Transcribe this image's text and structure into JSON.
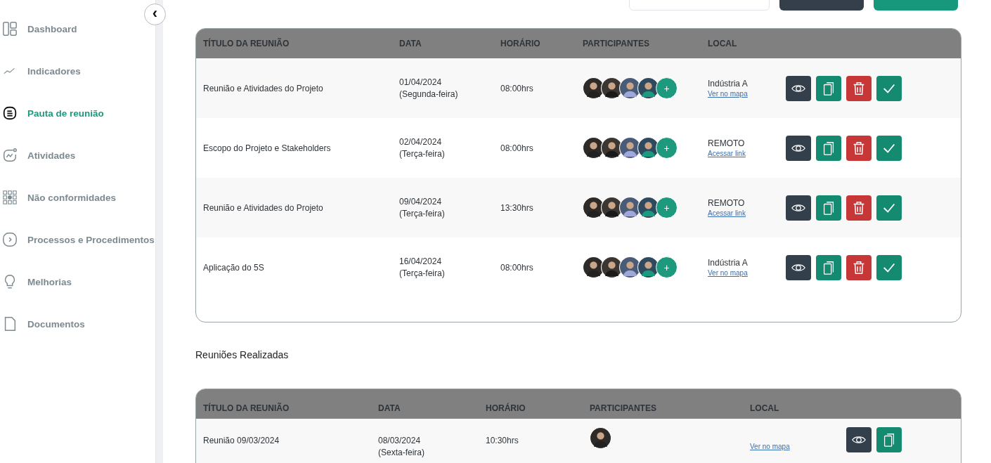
{
  "sidebar": {
    "collapse_label": "‹",
    "items": [
      {
        "label": "Dashboard",
        "selected": false
      },
      {
        "label": "Indicadores",
        "selected": false
      },
      {
        "label": "Pauta de reunião",
        "selected": true
      },
      {
        "label": "Atividades",
        "selected": false
      },
      {
        "label": "Não conformidades",
        "selected": false
      },
      {
        "label": "Processos e Procedimentos",
        "selected": false
      },
      {
        "label": "Melhorias",
        "selected": false
      },
      {
        "label": "Documentos",
        "selected": false
      }
    ]
  },
  "upcoming": {
    "columns": [
      "TÍTULO DA REUNIÃO",
      "DATA",
      "HORÁRIO",
      "PARTICIPANTES",
      "LOCAL"
    ],
    "rows": [
      {
        "title": "Reunião e Atividades do Projeto",
        "date": "01/04/2024",
        "weekday": "(Segunda-feira)",
        "time": "08:00hrs",
        "participants": [
          {
            "kind": "photo"
          },
          {
            "kind": "photo"
          },
          {
            "kind": "photo"
          },
          {
            "kind": "photo"
          },
          {
            "kind": "add",
            "label": "+"
          }
        ],
        "place": "Indústria A",
        "link": "Ver no mapa",
        "actions": [
          {
            "kind": "view"
          },
          {
            "kind": "copy"
          },
          {
            "kind": "delete"
          },
          {
            "kind": "confirm"
          }
        ]
      },
      {
        "title": "Escopo do Projeto e Stakeholders",
        "date": "02/04/2024",
        "weekday": "(Terça-feira)",
        "time": "08:00hrs",
        "participants": [
          {
            "kind": "photo"
          },
          {
            "kind": "photo"
          },
          {
            "kind": "photo"
          },
          {
            "kind": "photo"
          },
          {
            "kind": "add",
            "label": "+"
          }
        ],
        "place": "REMOTO",
        "link": "Acessar link",
        "actions": [
          {
            "kind": "view"
          },
          {
            "kind": "copy"
          },
          {
            "kind": "delete"
          },
          {
            "kind": "confirm"
          }
        ]
      },
      {
        "title": "Reunião e Atividades do Projeto",
        "date": "09/04/2024",
        "weekday": "(Terça-feira)",
        "time": "13:30hrs",
        "participants": [
          {
            "kind": "photo"
          },
          {
            "kind": "photo"
          },
          {
            "kind": "photo"
          },
          {
            "kind": "photo"
          },
          {
            "kind": "add",
            "label": "+"
          }
        ],
        "place": "REMOTO",
        "link": "Acessar link",
        "actions": [
          {
            "kind": "view"
          },
          {
            "kind": "copy"
          },
          {
            "kind": "delete"
          },
          {
            "kind": "confirm"
          }
        ]
      },
      {
        "title": "Aplicação do 5S",
        "date": "16/04/2024",
        "weekday": "(Terça-feira)",
        "time": "08:00hrs",
        "participants": [
          {
            "kind": "photo"
          },
          {
            "kind": "photo"
          },
          {
            "kind": "photo"
          },
          {
            "kind": "photo"
          },
          {
            "kind": "add",
            "label": "+"
          }
        ],
        "place": "Indústria A",
        "link": "Ver no mapa",
        "actions": [
          {
            "kind": "view"
          },
          {
            "kind": "copy"
          },
          {
            "kind": "delete"
          },
          {
            "kind": "confirm"
          }
        ]
      }
    ]
  },
  "done_heading": "Reuniões Realizadas",
  "done": {
    "columns": [
      "TÍTULO DA REUNIÃO",
      "DATA",
      "HORÁRIO",
      "PARTICIPANTES",
      "LOCAL"
    ],
    "rows": [
      {
        "title": "Reunião 09/03/2024",
        "date": "08/03/2024",
        "weekday": "(Sexta-feira)",
        "time": "10:30hrs",
        "participants": [
          {
            "kind": "photo"
          }
        ],
        "link": "Ver no mapa",
        "actions": [
          {
            "kind": "view"
          },
          {
            "kind": "copy"
          }
        ]
      }
    ]
  }
}
